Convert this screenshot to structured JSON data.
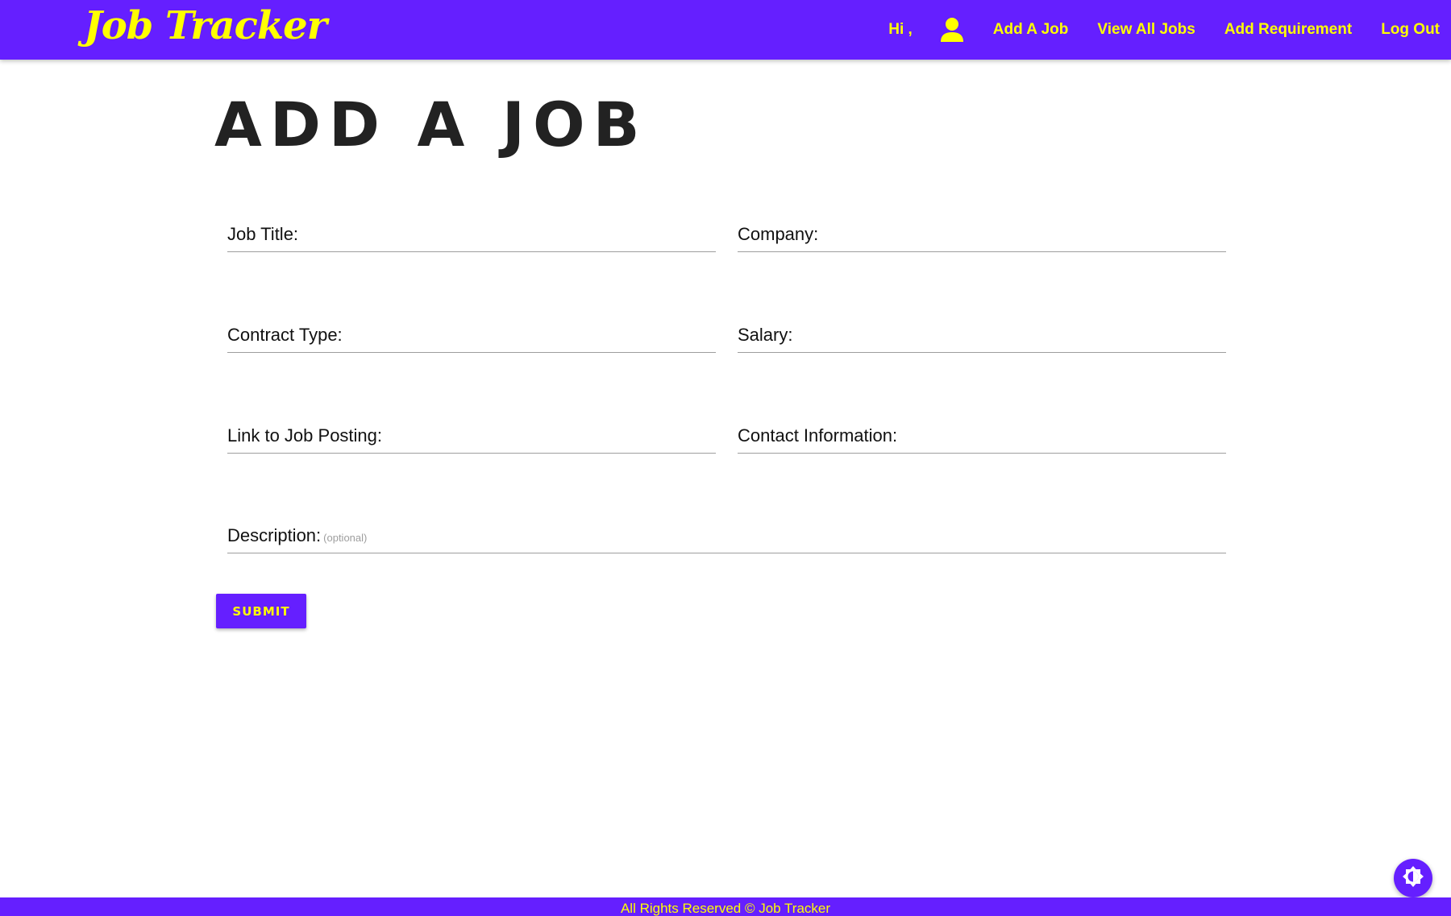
{
  "brand": "Job Tracker",
  "nav": {
    "greeting": "Hi ,",
    "user_icon": "person-icon",
    "links": [
      "Add A Job",
      "View All Jobs",
      "Add Requirement",
      "Log Out"
    ]
  },
  "page_title": "Add a job",
  "form": {
    "job_title_label": "Job Title:",
    "company_label": "Company:",
    "contract_type_label": "Contract Type:",
    "salary_label": "Salary:",
    "link_label": "Link to Job Posting:",
    "contact_label": "Contact Information:",
    "description_label": "Description:",
    "description_hint": "(optional)",
    "submit_label": "Submit"
  },
  "theme_toggle_icon": "brightness-icon",
  "footer": "All Rights Reserved © Job Tracker",
  "colors": {
    "primary": "#651fff",
    "accent": "#ffff00",
    "title_text": "#222222"
  }
}
